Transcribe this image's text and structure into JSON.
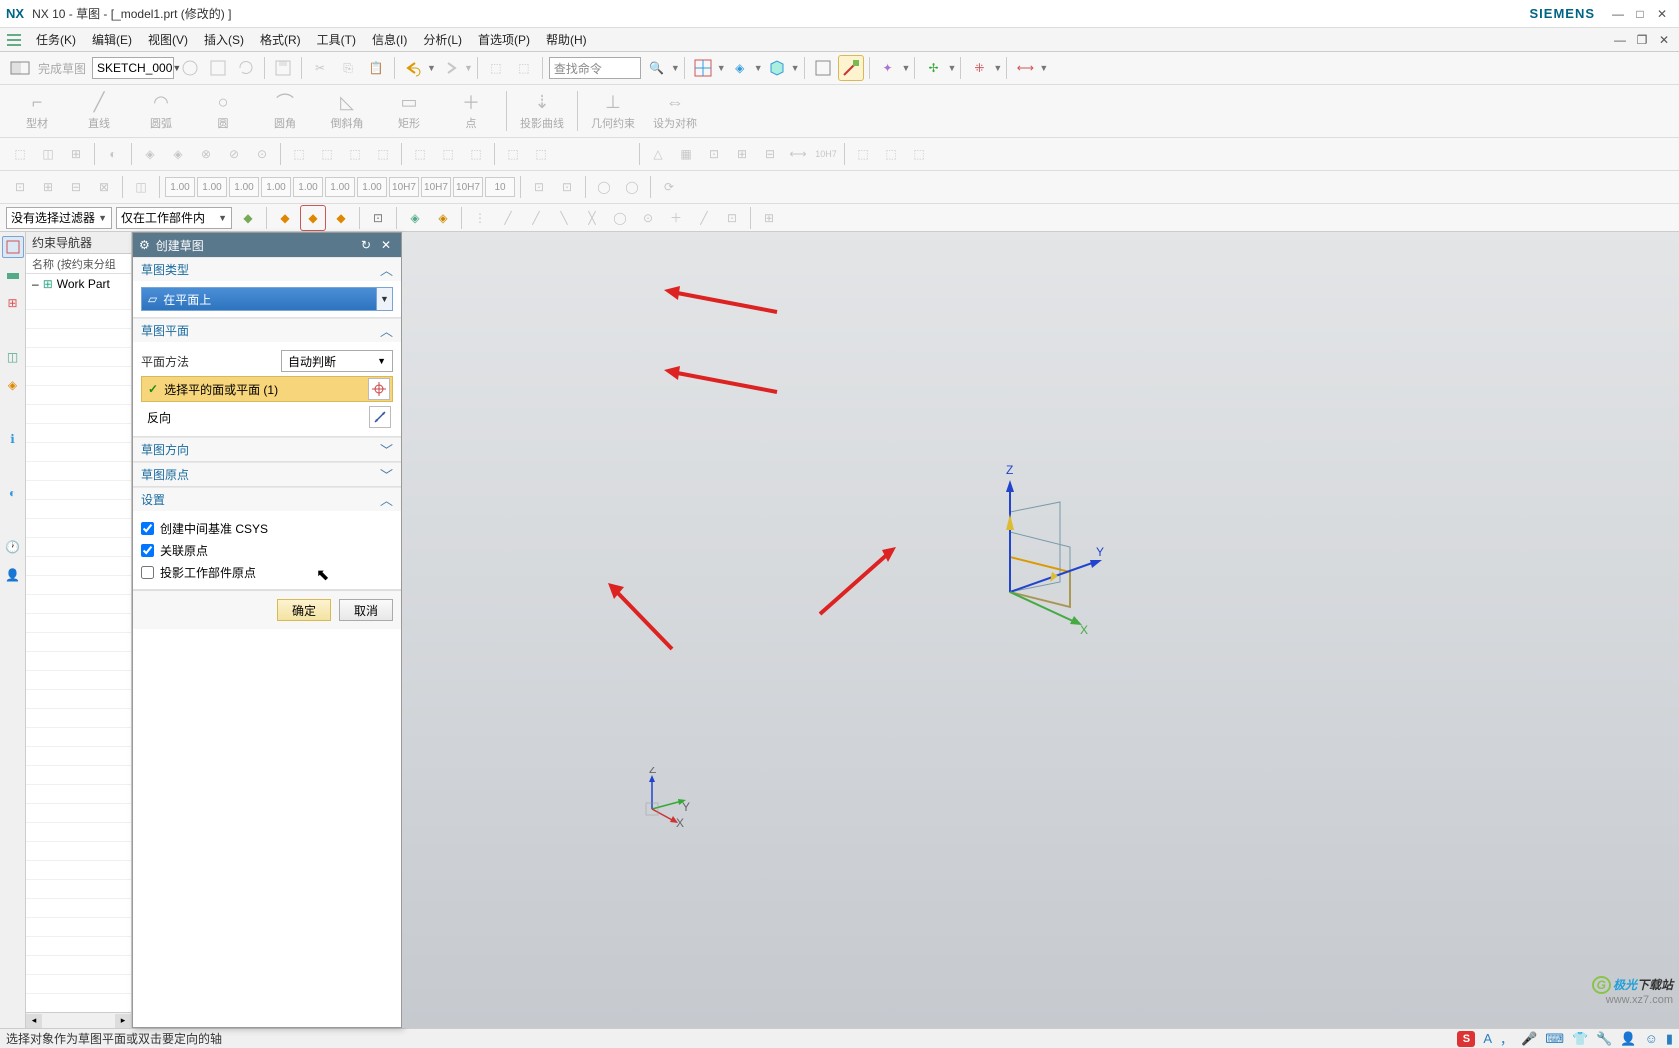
{
  "title": {
    "app": "NX",
    "version": "NX 10 - 草图 - [_model1.prt (修改的) ]",
    "brand": "SIEMENS"
  },
  "menu": {
    "items": [
      "任务(K)",
      "编辑(E)",
      "视图(V)",
      "插入(S)",
      "格式(R)",
      "工具(T)",
      "信息(I)",
      "分析(L)",
      "首选项(P)",
      "帮助(H)"
    ]
  },
  "toolbar1": {
    "finish_sketch": "完成草图",
    "sketch_combo": "SKETCH_000",
    "search_placeholder": "查找命令"
  },
  "bigtools": [
    {
      "label": "型材",
      "icon": "profile"
    },
    {
      "label": "直线",
      "icon": "line"
    },
    {
      "label": "圆弧",
      "icon": "arc"
    },
    {
      "label": "圆",
      "icon": "circle"
    },
    {
      "label": "圆角",
      "icon": "fillet"
    },
    {
      "label": "倒斜角",
      "icon": "chamfer"
    },
    {
      "label": "矩形",
      "icon": "rect"
    },
    {
      "label": "点",
      "icon": "point"
    },
    {
      "label": "投影曲线",
      "icon": "project"
    },
    {
      "label": "几何约束",
      "icon": "constraint"
    },
    {
      "label": "设为对称",
      "icon": "symmetric"
    }
  ],
  "dimrow": {
    "vals": [
      "1.00",
      "1.00",
      "1.00",
      "1.00",
      "1.00",
      "1.00",
      "1.00",
      "10H7",
      "10H7",
      "10H7",
      "10"
    ]
  },
  "filter": {
    "sel_filter": "没有选择过滤器",
    "scope": "仅在工作部件内"
  },
  "navigator": {
    "title": "约束导航器",
    "col": "名称 (按约束分组",
    "root": "Work Part"
  },
  "dialog": {
    "title": "创建草图",
    "s_type": "草图类型",
    "type_combo": "在平面上",
    "s_plane": "草图平面",
    "plane_method_label": "平面方法",
    "plane_method_value": "自动判断",
    "select_plane": "选择平的面或平面 (1)",
    "reverse": "反向",
    "s_orient": "草图方向",
    "s_origin": "草图原点",
    "s_settings": "设置",
    "cb1": "创建中间基准 CSYS",
    "cb2": "关联原点",
    "cb3": "投影工作部件原点",
    "ok": "确定",
    "cancel": "取消"
  },
  "axes": {
    "x": "X",
    "y": "Y",
    "z": "Z"
  },
  "status": {
    "msg": "选择对象作为草图平面或双击要定向的轴",
    "ime": "S"
  },
  "watermark": {
    "line1a": "极光",
    "line1b": "下载站",
    "line2": "www.xz7.com"
  }
}
